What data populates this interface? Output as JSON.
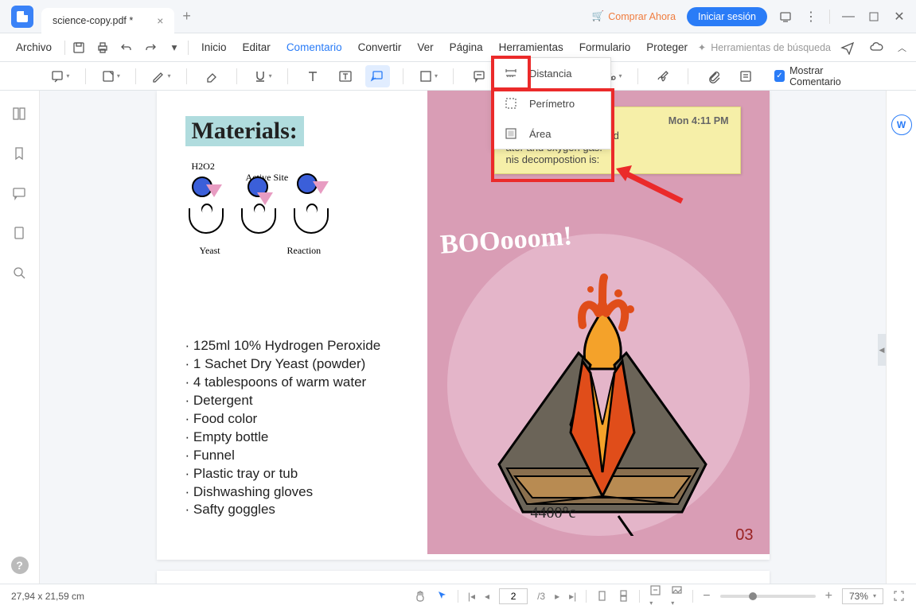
{
  "titlebar": {
    "tab_name": "science-copy.pdf *",
    "buy_label": "Comprar Ahora",
    "login_label": "Iniciar sesión"
  },
  "menubar": {
    "file": "Archivo",
    "items": [
      "Inicio",
      "Editar",
      "Comentario",
      "Convertir",
      "Ver",
      "Página",
      "Herramientas",
      "Formulario",
      "Proteger"
    ],
    "active_index": 2,
    "search_placeholder": "Herramientas de búsqueda"
  },
  "toolbar": {
    "show_comment": "Mostrar Comentario"
  },
  "dropdown": {
    "items": [
      {
        "icon": "distance-icon",
        "label": "Distancia"
      },
      {
        "icon": "perimeter-icon",
        "label": "Perímetro"
      },
      {
        "icon": "area-icon",
        "label": "Área"
      }
    ]
  },
  "document": {
    "materials_title": "Materials:",
    "diagram_labels": {
      "h2o2": "H2O2",
      "active_site": "Active Site",
      "yeast": "Yeast",
      "reaction": "Reaction"
    },
    "materials_list": [
      "125ml 10% Hydrogen Peroxide",
      "1 Sachet Dry Yeast (powder)",
      "4 tablespoons of warm water",
      "Detergent",
      "Food color",
      "Empty bottle",
      "Funnel",
      "Plastic tray or tub",
      "Dishwashing gloves",
      "Safty goggles"
    ],
    "note": {
      "time": "Mon 4:11 PM",
      "line1": "es are very unstable and",
      "line2": "ater and oxygen gas.",
      "line3": "nis decompostion is:"
    },
    "boom": "BOOooom!",
    "temp": "4400°c",
    "page_num": "03"
  },
  "statusbar": {
    "coords": "27,94 x 21,59 cm",
    "page_current": "2",
    "page_total": "/3",
    "zoom": "73%"
  }
}
